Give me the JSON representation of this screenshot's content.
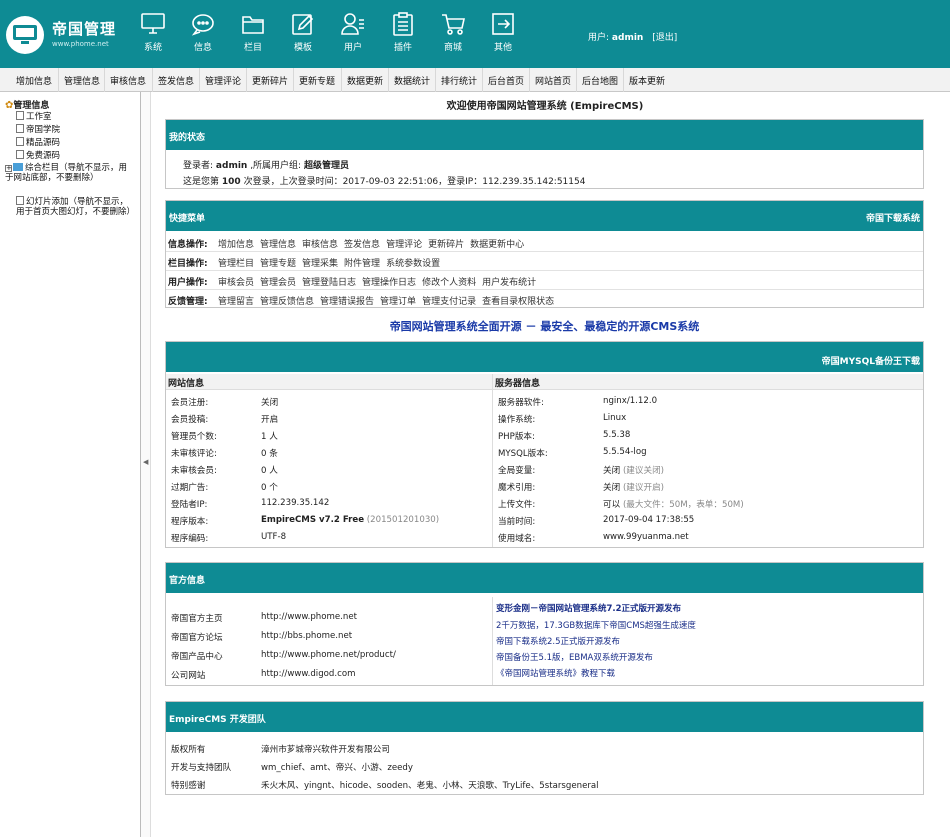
{
  "header": {
    "logo_title": "帝国管理",
    "logo_sub": "www.phome.net",
    "nav": [
      {
        "label": "系统",
        "icon": "monitor-icon"
      },
      {
        "label": "信息",
        "icon": "chat-bubble-icon"
      },
      {
        "label": "栏目",
        "icon": "folder-icon"
      },
      {
        "label": "模板",
        "icon": "edit-icon"
      },
      {
        "label": "用户",
        "icon": "user-icon"
      },
      {
        "label": "插件",
        "icon": "clipboard-icon"
      },
      {
        "label": "商城",
        "icon": "cart-icon"
      },
      {
        "label": "其他",
        "icon": "exit-icon"
      }
    ],
    "user_label": "用户:",
    "username": "admin",
    "logout": "[退出]"
  },
  "menubar": [
    "增加信息",
    "管理信息",
    "审核信息",
    "签发信息",
    "管理评论",
    "更新碎片",
    "更新专题",
    "数据更新",
    "数据统计",
    "排行统计",
    "后台首页",
    "网站首页",
    "后台地图",
    "版本更新"
  ],
  "tree": {
    "root": "管理信息",
    "items": [
      {
        "label": "工作室",
        "type": "doc"
      },
      {
        "label": "帝国学院",
        "type": "doc"
      },
      {
        "label": "精品源码",
        "type": "doc"
      },
      {
        "label": "免费源码",
        "type": "doc"
      },
      {
        "label": "综合栏目（导航不显示，用于网站底部，不要删除）",
        "type": "folder"
      },
      {
        "label": "幻灯片添加（导航不显示，用于首页大图幻灯，不要删除）",
        "type": "doc"
      }
    ]
  },
  "welcome": "欢迎使用帝国网站管理系统 (EmpireCMS)",
  "status": {
    "title": "我的状态",
    "line1_label": "登录者:",
    "line1_user": "admin",
    "line1_group_label": ",所属用户组:",
    "line1_group": "超级管理员",
    "line2_a": "这是您第",
    "line2_count": "100",
    "line2_b": "次登录，上次登录时间：2017-09-03 22:51:06，登录IP：112.239.35.142:51154"
  },
  "quick": {
    "title": "快捷菜单",
    "right_link": "帝国下载系统",
    "rows": [
      {
        "label": "信息操作:",
        "links": [
          "增加信息",
          "管理信息",
          "审核信息",
          "签发信息",
          "管理评论",
          "更新碎片",
          "数据更新中心"
        ]
      },
      {
        "label": "栏目操作:",
        "links": [
          "管理栏目",
          "管理专题",
          "管理采集",
          "附件管理",
          "系统参数设置"
        ]
      },
      {
        "label": "用户操作:",
        "links": [
          "审核会员",
          "管理会员",
          "管理登陆日志",
          "管理操作日志",
          "修改个人资料",
          "用户发布统计"
        ]
      },
      {
        "label": "反馈管理:",
        "links": [
          "管理留言",
          "管理反馈信息",
          "管理错误报告",
          "管理订单",
          "管理支付记录",
          "查看目录权限状态"
        ]
      }
    ]
  },
  "slogan": "帝国网站管理系统全面开源 － 最安全、最稳定的开源CMS系统",
  "siteinfo": {
    "right_link": "帝国MYSQL备份王下载",
    "left_title": "网站信息",
    "right_title": "服务器信息",
    "left": [
      {
        "k": "会员注册:",
        "v": "关闭"
      },
      {
        "k": "会员投稿:",
        "v": "开启"
      },
      {
        "k": "管理员个数:",
        "v": "1 人"
      },
      {
        "k": "未审核评论:",
        "v": "0 条"
      },
      {
        "k": "未审核会员:",
        "v": "0 人"
      },
      {
        "k": "过期广告:",
        "v": "0 个"
      },
      {
        "k": "登陆者IP:",
        "v": "112.239.35.142"
      },
      {
        "k": "程序版本:",
        "v": "EmpireCMS v7.2 Free",
        "hint": "(201501201030)"
      },
      {
        "k": "程序编码:",
        "v": "UTF-8"
      }
    ],
    "right": [
      {
        "k": "服务器软件:",
        "v": "nginx/1.12.0"
      },
      {
        "k": "操作系统:",
        "v": "Linux"
      },
      {
        "k": "PHP版本:",
        "v": "5.5.38"
      },
      {
        "k": "MYSQL版本:",
        "v": "5.5.54-log"
      },
      {
        "k": "全局变量:",
        "v": "关闭",
        "hint": "(建议关闭)"
      },
      {
        "k": "魔术引用:",
        "v": "关闭",
        "hint": "(建议开启)"
      },
      {
        "k": "上传文件:",
        "v": "可以",
        "hint": "(最大文件：50M，表单：50M)"
      },
      {
        "k": "当前时间:",
        "v": "2017-09-04 17:38:55"
      },
      {
        "k": "使用域名:",
        "v": "www.99yuanma.net"
      }
    ]
  },
  "official": {
    "title": "官方信息",
    "links": [
      {
        "k": "帝国官方主页",
        "v": "http://www.phome.net"
      },
      {
        "k": "帝国官方论坛",
        "v": "http://bbs.phome.net"
      },
      {
        "k": "帝国产品中心",
        "v": "http://www.phome.net/product/"
      },
      {
        "k": "公司网站",
        "v": "http://www.digod.com"
      }
    ],
    "news": [
      "变形金刚－帝国网站管理系统7.2正式版开源发布",
      "2千万数据，17.3GB数据库下帝国CMS超强生成速度",
      "帝国下载系统2.5正式版开源发布",
      "帝国备份王5.1版，EBMA双系统开源发布",
      "《帝国网站管理系统》教程下载"
    ]
  },
  "team": {
    "title": "EmpireCMS 开发团队",
    "rows": [
      {
        "k": "版权所有",
        "v": "漳州市芗城帝兴软件开发有限公司"
      },
      {
        "k": "开发与支持团队",
        "v": "wm_chief、amt、帝兴、小游、zeedy"
      },
      {
        "k": "特别感谢",
        "v": "禾火木风、yingnt、hicode、sooden、老鬼、小林、天浪歌、TryLife、5starsgeneral"
      }
    ]
  },
  "colors": {
    "header_bg": "#0e8b94",
    "slogan": "#1a3aa8",
    "news": "#1a2e88"
  }
}
